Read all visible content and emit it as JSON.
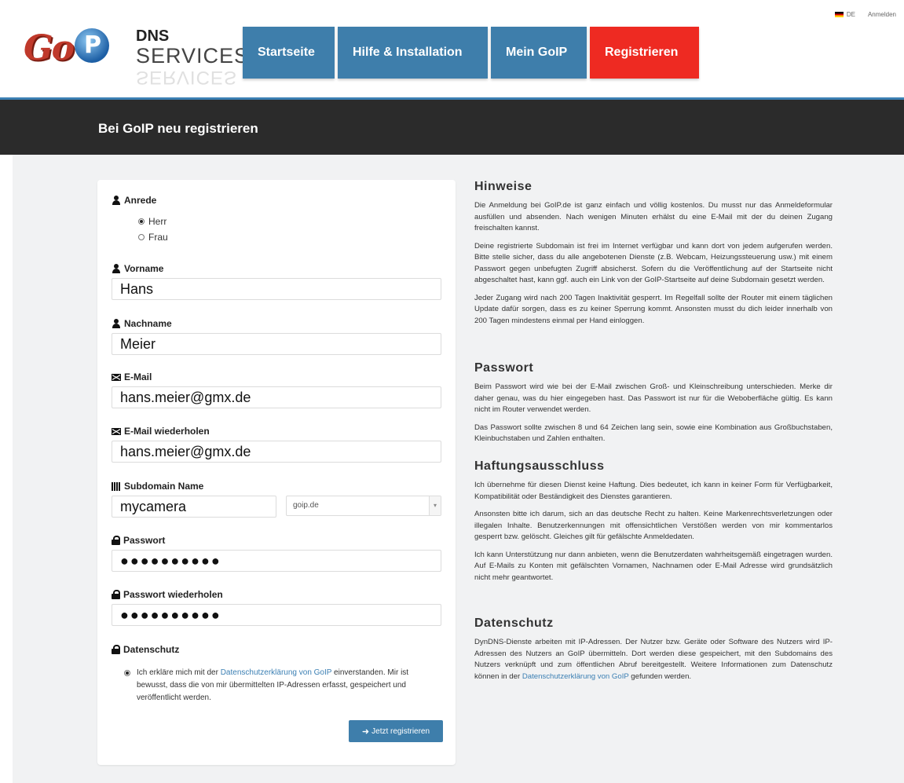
{
  "topbar": {
    "lang": "DE",
    "login": "Anmelden"
  },
  "logo": {
    "goip": "Go",
    "p": "P",
    "dns": "DNS",
    "services": "SERVICES"
  },
  "nav": [
    {
      "label": "Startseite"
    },
    {
      "label": "Hilfe & Installation"
    },
    {
      "label": "Mein GoIP"
    },
    {
      "label": "Registrieren"
    }
  ],
  "colors": {
    "nav_blue": "#3e7eab",
    "nav_active": "#ee2a22",
    "titlebar": "#2b2b2b",
    "accent": "#3b7fb3"
  },
  "page_title": "Bei GoIP neu registrieren",
  "form": {
    "anrede_label": "Anrede",
    "anrede_options": [
      "Herr",
      "Frau"
    ],
    "anrede_selected": "Herr",
    "vorname_label": "Vorname",
    "vorname_value": "Hans",
    "nachname_label": "Nachname",
    "nachname_value": "Meier",
    "email_label": "E-Mail",
    "email_value": "hans.meier@gmx.de",
    "email2_label": "E-Mail wiederholen",
    "email2_value": "hans.meier@gmx.de",
    "subdomain_label": "Subdomain Name",
    "subdomain_value": "mycamera",
    "domain_select": "goip.de",
    "passwort_label": "Passwort",
    "passwort_value": "●●●●●●●●●●",
    "passwort2_label": "Passwort wiederholen",
    "passwort2_value": "●●●●●●●●●●",
    "datenschutz_label": "Datenschutz",
    "consent_pre": "Ich erkläre mich mit der ",
    "consent_link": "Datenschutzerklärung von GoIP",
    "consent_post": " einverstanden. Mir ist bewusst, dass die von mir übermittelten IP-Adressen erfasst, gespeichert und veröffentlicht werden.",
    "submit_label": "Jetzt registrieren"
  },
  "info": {
    "hinweise_title": "Hinweise",
    "hinweise_p1": "Die Anmeldung bei GoIP.de ist ganz einfach und völlig kostenlos. Du musst nur das Anmeldeformular ausfüllen und absenden. Nach wenigen Minuten erhälst du eine E-Mail mit der du deinen Zugang freischalten kannst.",
    "hinweise_p2": "Deine registrierte Subdomain ist frei im Internet verfügbar und kann dort von jedem aufgerufen werden. Bitte stelle sicher, dass du alle angebotenen Dienste (z.B. Webcam, Heizungssteuerung usw.) mit einem Passwort gegen unbefugten Zugriff absicherst. Sofern du die Veröffentlichung auf der Startseite nicht abgeschaltet hast, kann ggf. auch ein Link von der GoIP-Startseite auf deine Subdomain gesetzt werden.",
    "hinweise_p3": "Jeder Zugang wird nach 200 Tagen Inaktivität gesperrt. Im Regelfall sollte der Router mit einem täglichen Update dafür sorgen, dass es zu keiner Sperrung kommt. Ansonsten musst du dich leider innerhalb von 200 Tagen mindestens einmal per Hand einloggen.",
    "passwort_title": "Passwort",
    "passwort_p1": "Beim Passwort wird wie bei der E-Mail zwischen Groß- und Kleinschreibung unterschieden. Merke dir daher genau, was du hier eingegeben hast. Das Passwort ist nur für die Weboberfläche gültig. Es kann nicht im Router verwendet werden.",
    "passwort_p2": "Das Passwort sollte zwischen 8 und 64 Zeichen lang sein, sowie eine Kombination aus Großbuchstaben, Kleinbuchstaben und Zahlen enthalten.",
    "haftung_title": "Haftungsausschluss",
    "haftung_p1": "Ich übernehme für diesen Dienst keine Haftung. Dies bedeutet, ich kann in keiner Form für Verfügbarkeit, Kompatibilität oder Beständigkeit des Dienstes garantieren.",
    "haftung_p2": "Ansonsten bitte ich darum, sich an das deutsche Recht zu halten. Keine Markenrechtsverletzungen oder illegalen Inhalte. Benutzerkennungen mit offensichtlichen Verstößen werden von mir kommentarlos gesperrt bzw. gelöscht. Gleiches gilt für gefälschte Anmeldedaten.",
    "haftung_p3": "Ich kann Unterstützung nur dann anbieten, wenn die Benutzerdaten wahrheitsgemäß eingetragen wurden. Auf E-Mails zu Konten mit gefälschten Vornamen, Nachnamen oder E-Mail Adresse wird grundsätzlich nicht mehr geantwortet.",
    "datenschutz_title": "Datenschutz",
    "datenschutz_p1_pre": "DynDNS-Dienste arbeiten mit IP-Adressen. Der Nutzer bzw. Geräte oder Software des Nutzers wird IP-Adressen des Nutzers an GoIP übermitteln. Dort werden diese gespeichert, mit den Subdomains des Nutzers verknüpft und zum öffentlichen Abruf bereitgestellt. Weitere Informationen zum Datenschutz können in der ",
    "datenschutz_link": "Datenschutzerklärung von GoIP",
    "datenschutz_p1_post": " gefunden werden."
  }
}
